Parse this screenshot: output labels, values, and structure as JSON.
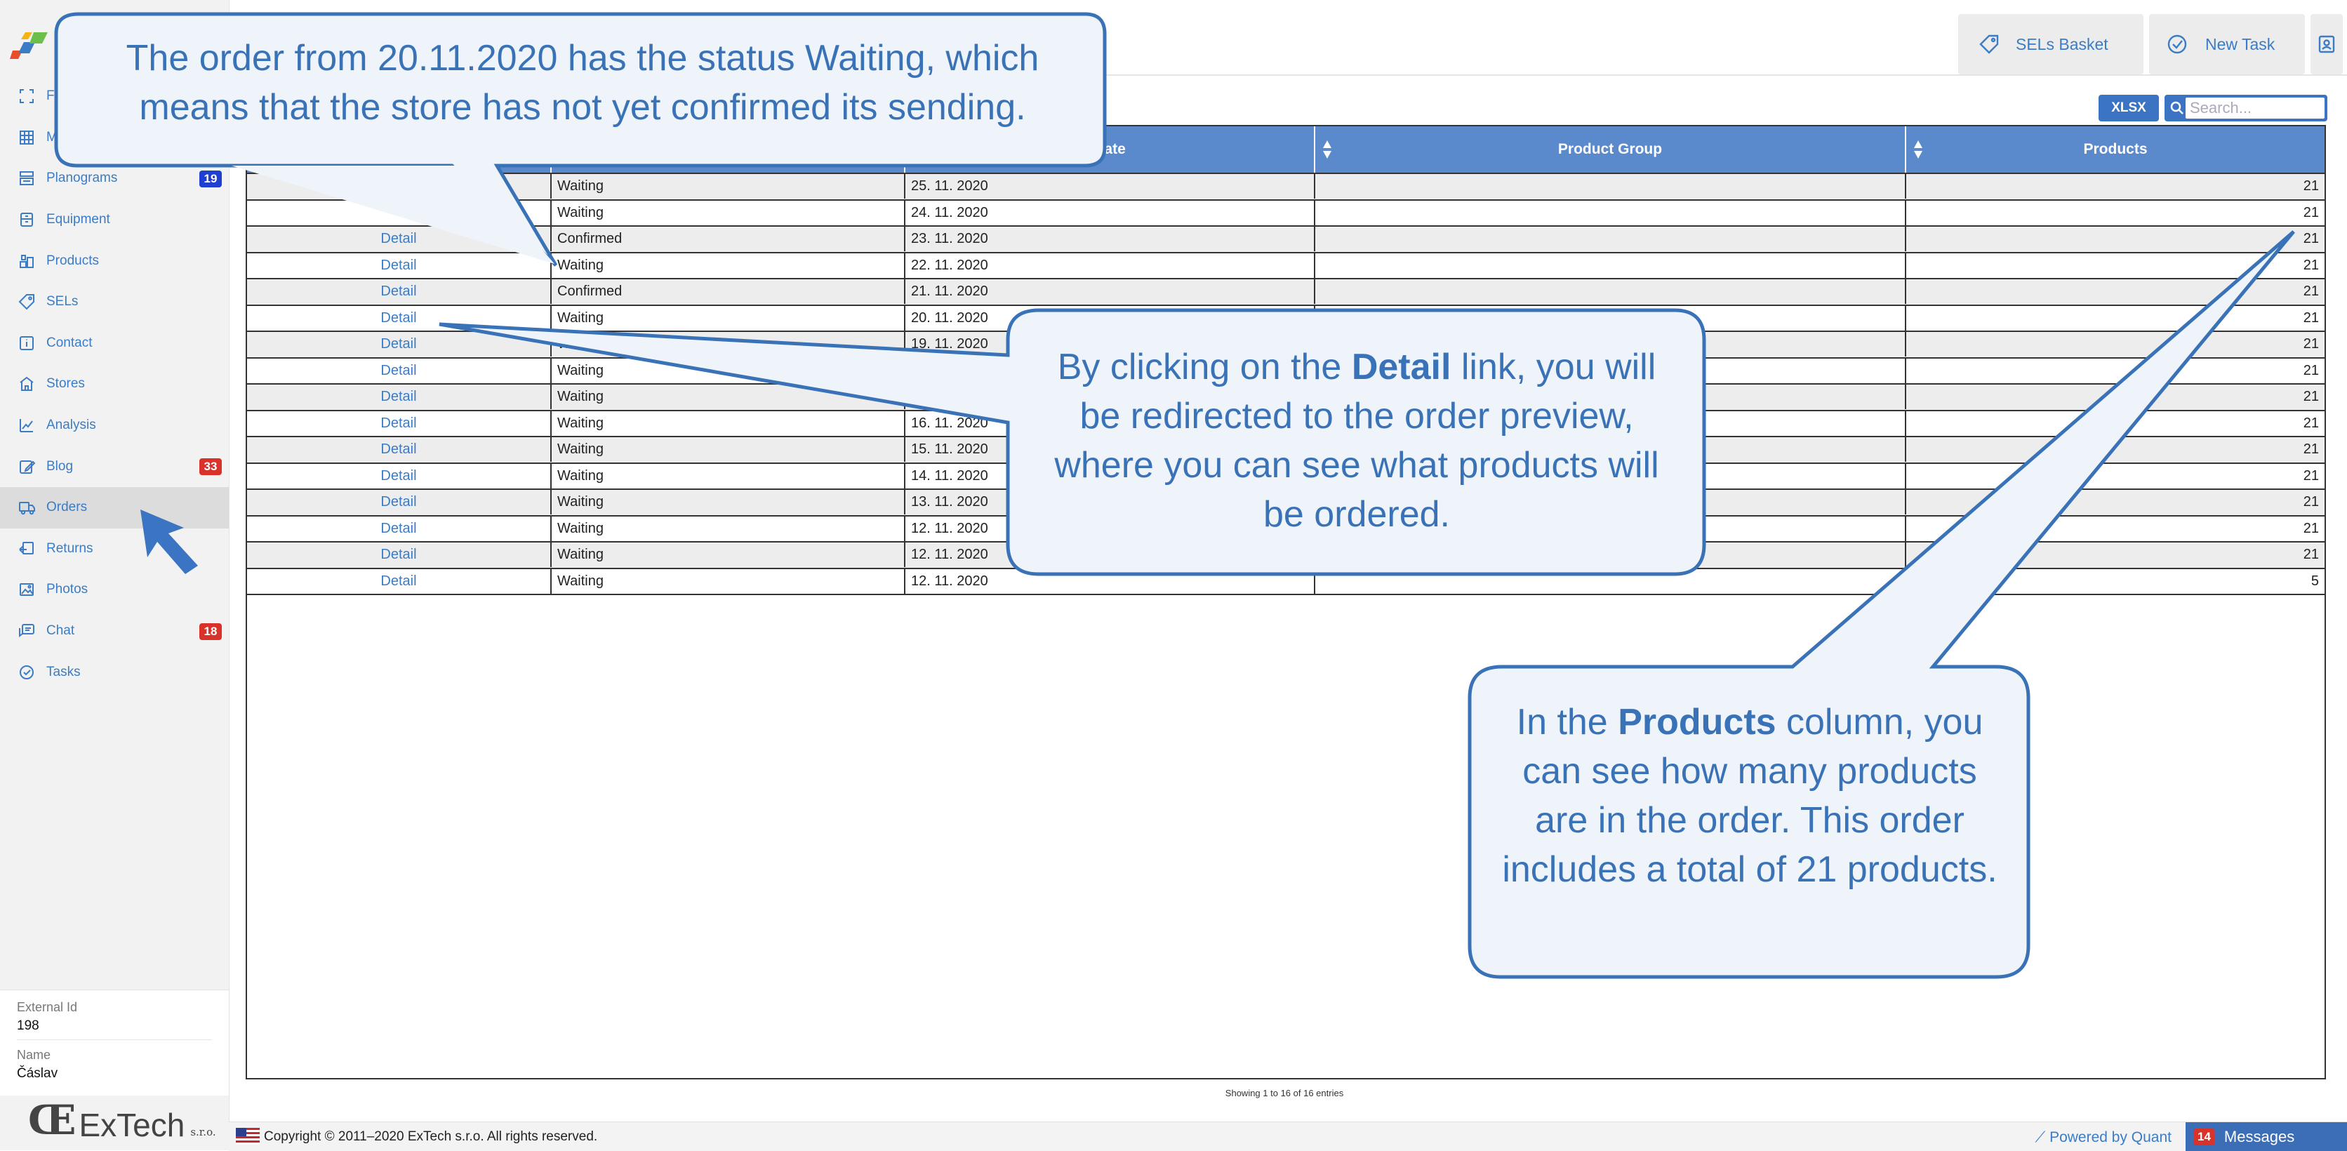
{
  "sidebar": {
    "items": [
      {
        "label": "F",
        "icon": "expand-icon",
        "badge": ""
      },
      {
        "label": "M",
        "icon": "grid-icon",
        "badge": ""
      },
      {
        "label": "Planograms",
        "icon": "planogram-icon",
        "badge": "19"
      },
      {
        "label": "Equipment",
        "icon": "equipment-icon",
        "badge": ""
      },
      {
        "label": "Products",
        "icon": "products-icon",
        "badge": ""
      },
      {
        "label": "SELs",
        "icon": "tag-icon",
        "badge": ""
      },
      {
        "label": "Contact",
        "icon": "info-icon",
        "badge": ""
      },
      {
        "label": "Stores",
        "icon": "store-icon",
        "badge": ""
      },
      {
        "label": "Analysis",
        "icon": "chart-icon",
        "badge": ""
      },
      {
        "label": "Blog",
        "icon": "edit-icon",
        "badge": "33"
      },
      {
        "label": "Orders",
        "icon": "truck-icon",
        "badge": ""
      },
      {
        "label": "Returns",
        "icon": "returns-icon",
        "badge": ""
      },
      {
        "label": "Photos",
        "icon": "photo-icon",
        "badge": ""
      },
      {
        "label": "Chat",
        "icon": "chat-icon",
        "badge": "18"
      },
      {
        "label": "Tasks",
        "icon": "check-circle-icon",
        "badge": ""
      }
    ],
    "active": "Orders",
    "external_id_label": "External Id",
    "external_id_value": "198",
    "name_label": "Name",
    "name_value": "Čáslav",
    "brand_name": "ExTech",
    "brand_suffix": "s.r.o."
  },
  "topbar": {
    "sels_basket": "SELs Basket",
    "new_task": "New Task"
  },
  "table": {
    "xlsx_label": "XLSX",
    "search_placeholder": "Search...",
    "headers": {
      "date": "Date",
      "group": "Product Group",
      "products": "Products"
    },
    "rows": [
      {
        "detail": "",
        "status": "Waiting",
        "date": "25. 11. 2020",
        "group": "",
        "products": "21"
      },
      {
        "detail": "",
        "status": "Waiting",
        "date": "24. 11. 2020",
        "group": "",
        "products": "21"
      },
      {
        "detail": "Detail",
        "status": "Confirmed",
        "date": "23. 11. 2020",
        "group": "",
        "products": "21"
      },
      {
        "detail": "Detail",
        "status": "Waiting",
        "date": "22. 11. 2020",
        "group": "",
        "products": "21"
      },
      {
        "detail": "Detail",
        "status": "Confirmed",
        "date": "21. 11. 2020",
        "group": "",
        "products": "21"
      },
      {
        "detail": "Detail",
        "status": "Waiting",
        "date": "20. 11. 2020",
        "group": "",
        "products": "21"
      },
      {
        "detail": "Detail",
        "status": "W",
        "date": "19. 11. 2020",
        "group": "",
        "products": "21"
      },
      {
        "detail": "Detail",
        "status": "Waiting",
        "date": "",
        "group": "",
        "products": "21"
      },
      {
        "detail": "Detail",
        "status": "Waiting",
        "date": "",
        "group": "",
        "products": "21"
      },
      {
        "detail": "Detail",
        "status": "Waiting",
        "date": "16. 11. 2020",
        "group": "",
        "products": "21"
      },
      {
        "detail": "Detail",
        "status": "Waiting",
        "date": "15. 11. 2020",
        "group": "",
        "products": "21"
      },
      {
        "detail": "Detail",
        "status": "Waiting",
        "date": "14. 11. 2020",
        "group": "",
        "products": "21"
      },
      {
        "detail": "Detail",
        "status": "Waiting",
        "date": "13. 11. 2020",
        "group": "",
        "products": "21"
      },
      {
        "detail": "Detail",
        "status": "Waiting",
        "date": "12. 11. 2020",
        "group": "",
        "products": "21"
      },
      {
        "detail": "Detail",
        "status": "Waiting",
        "date": "12. 11. 2020",
        "group": "",
        "products": "21"
      },
      {
        "detail": "Detail",
        "status": "Waiting",
        "date": "12. 11. 2020",
        "group": "",
        "products": "5"
      }
    ],
    "info": "Showing 1 to 16 of 16 entries"
  },
  "footer": {
    "copyright": "Copyright © 2011–2020 ExTech s.r.o. All rights reserved.",
    "powered": "Powered by Quant",
    "messages_count": "14",
    "messages_label": "Messages"
  },
  "callouts": {
    "status": "The order from 20.11.2020 has the status Waiting, which means that the store has not yet confirmed its sending.",
    "detail_pre": "By clicking on the ",
    "detail_bold": "Detail",
    "detail_post": " link, you will be redirected to the order preview, where you can see what products will be ordered.",
    "products_pre": "In the ",
    "products_bold": "Products",
    "products_post": " column, you can see how many products are in the order. This order includes a total of 21 products."
  },
  "colors": {
    "accent": "#3b7cc4",
    "header_blue": "#5a8acb",
    "badge_red": "#d9322b",
    "badge_blue": "#1f3fd1",
    "callout_fill": "#eef4f9"
  }
}
